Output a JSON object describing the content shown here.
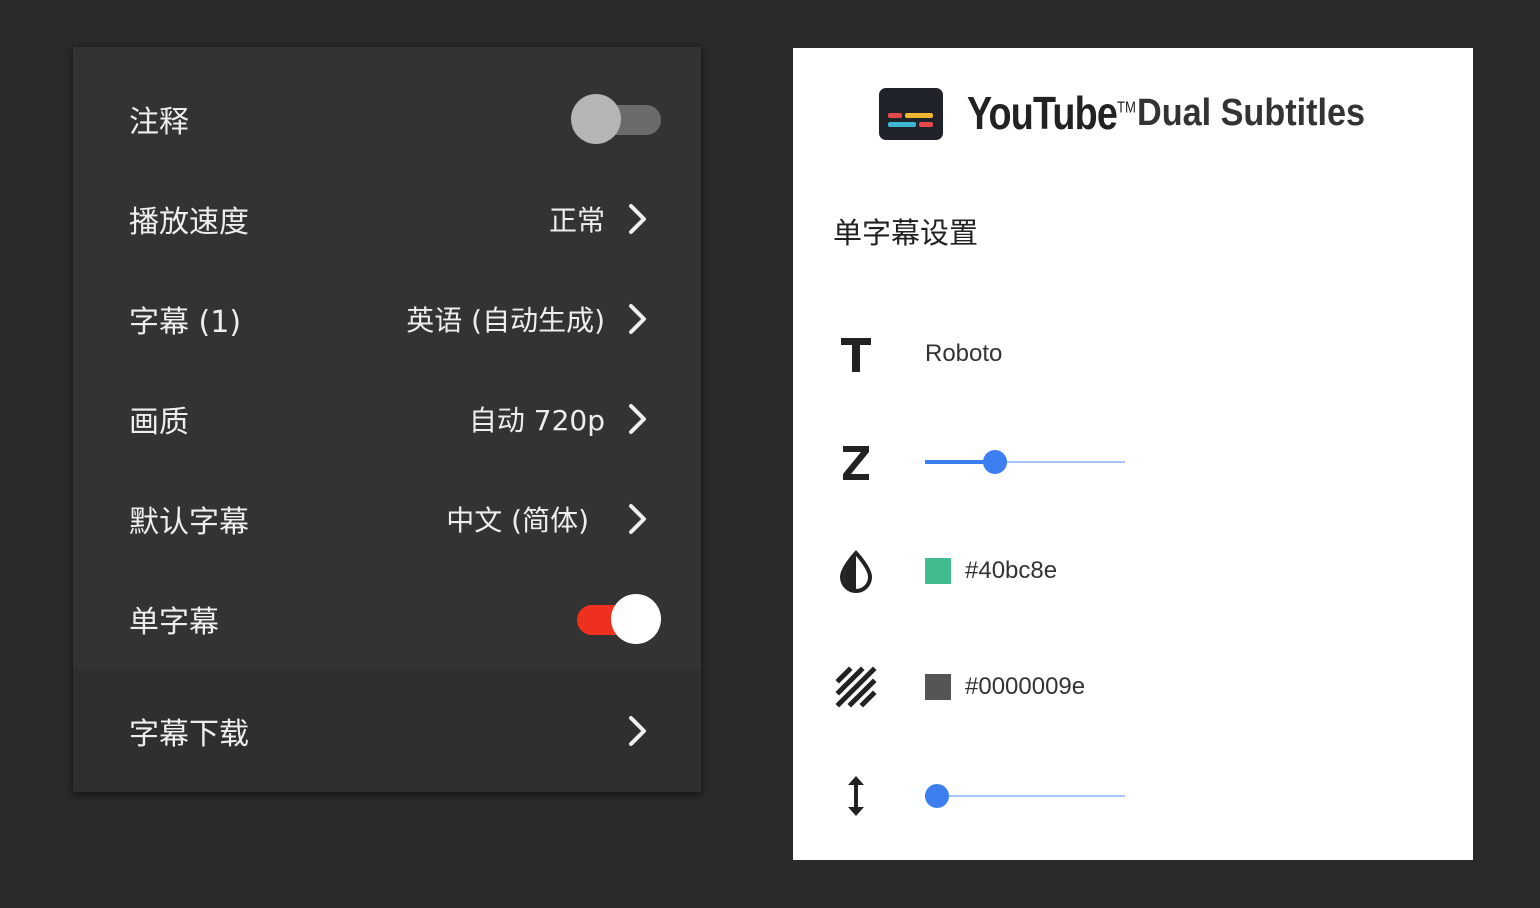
{
  "colors": {
    "toggle_on": "#f0301f",
    "toggle_off": "#6b6b6b",
    "slider_accent": "#3d7ff0",
    "swatch_text": "#40bc8e",
    "swatch_background": "#555555"
  },
  "player_menu": {
    "items": [
      {
        "label": "注释",
        "type": "toggle",
        "on": false
      },
      {
        "label": "播放速度",
        "value": "正常",
        "type": "submenu"
      },
      {
        "label": "字幕 (1)",
        "value": "英语 (自动生成)",
        "type": "submenu"
      },
      {
        "label": "画质",
        "value": "自动 720p",
        "type": "submenu"
      },
      {
        "label": "默认字幕",
        "value": "中文 (简体)",
        "type": "submenu"
      },
      {
        "label": "单字幕",
        "type": "toggle",
        "on": true
      },
      {
        "label": "字幕下载",
        "value": "",
        "type": "submenu"
      }
    ],
    "chevron_icon": "chevron-right-icon"
  },
  "extension": {
    "brand": "YouTube",
    "trademark": "TM",
    "product": "Dual Subtitles",
    "logo_icon": "subtitles-logo-icon",
    "section_title": "单字幕设置",
    "font": {
      "icon": "text-font-icon",
      "value": "Roboto"
    },
    "size": {
      "icon": "z-size-icon",
      "level": 0.35
    },
    "text_color": {
      "icon": "contrast-drop-icon",
      "value": "#40bc8e"
    },
    "background_color": {
      "icon": "hatch-pattern-icon",
      "value": "#0000009e"
    },
    "vertical_position": {
      "icon": "vertical-arrows-icon",
      "level": 0.06
    }
  }
}
